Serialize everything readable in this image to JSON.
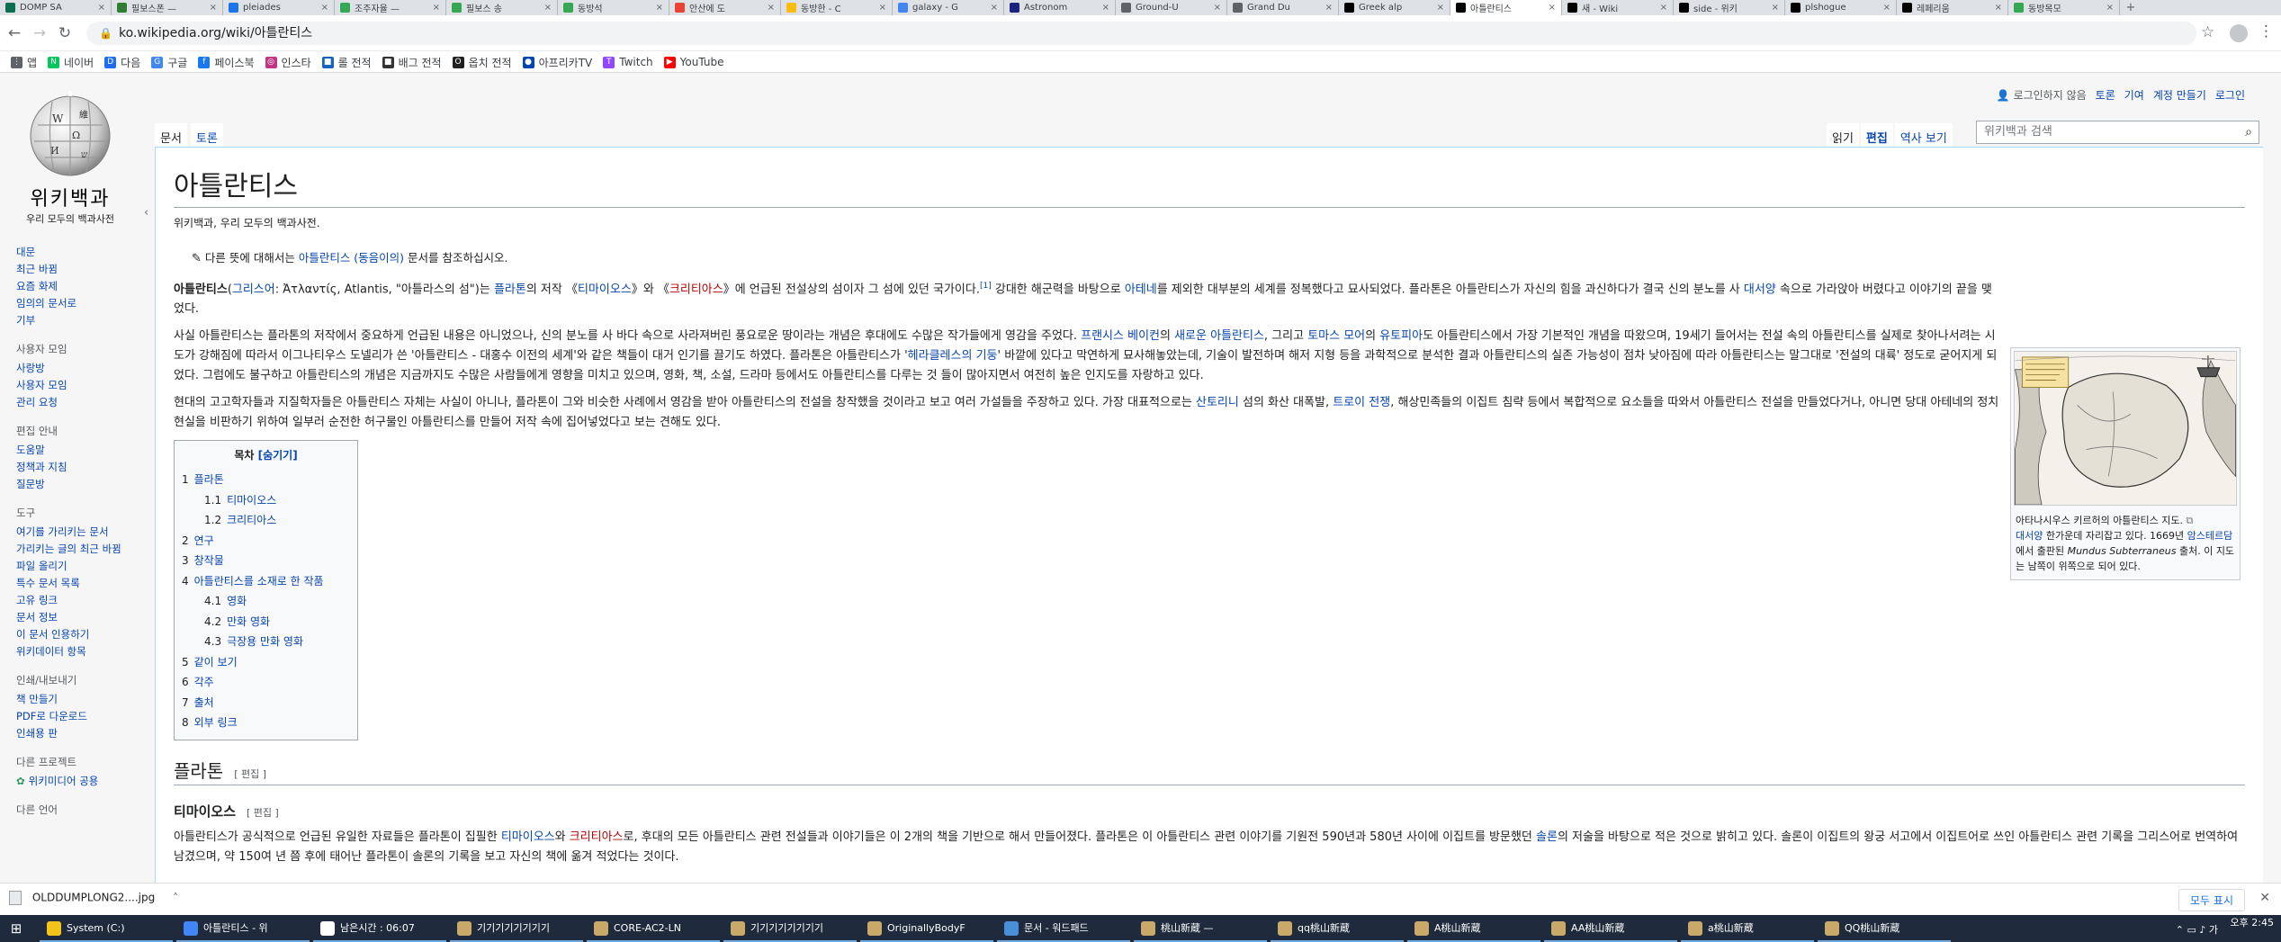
{
  "browser": {
    "tabs": [
      {
        "title": "DOMP SA",
        "color": "#0b6e4f"
      },
      {
        "title": "필보스폰 —",
        "color": "#2e7d32"
      },
      {
        "title": "pleiades",
        "color": "#1a73e8"
      },
      {
        "title": "조주자율 —",
        "color": "#34a853"
      },
      {
        "title": "필보스 송",
        "color": "#34a853"
      },
      {
        "title": "동방석",
        "color": "#34a853"
      },
      {
        "title": "안산에 도",
        "color": "#ea4335"
      },
      {
        "title": "동방한 - C",
        "color": "#fbbc04"
      },
      {
        "title": "galaxy - G",
        "color": "#4285f4"
      },
      {
        "title": "Astronom",
        "color": "#1a237e"
      },
      {
        "title": "Ground-U",
        "color": "#5f6368"
      },
      {
        "title": "Grand Du",
        "color": "#5f6368"
      },
      {
        "title": "Greek alp",
        "color": "#000000"
      },
      {
        "title": "아틀란티스",
        "color": "#000000",
        "active": true
      },
      {
        "title": "새 - Wiki",
        "color": "#000000"
      },
      {
        "title": "side - 위키",
        "color": "#000000"
      },
      {
        "title": "plshogue",
        "color": "#000000"
      },
      {
        "title": "레페리움",
        "color": "#000000"
      },
      {
        "title": "동방목모",
        "color": "#34a853"
      }
    ],
    "new_tab": "+",
    "url": "ko.wikipedia.org/wiki/아틀란티스",
    "bookmarks": [
      {
        "label": "앱",
        "color": "#5f6368",
        "glyph": "⋮"
      },
      {
        "label": "네이버",
        "color": "#03c75a",
        "glyph": "N"
      },
      {
        "label": "다음",
        "color": "#1e6ef4",
        "glyph": "D"
      },
      {
        "label": "구글",
        "color": "#4285f4",
        "glyph": "G"
      },
      {
        "label": "페이스북",
        "color": "#1877f2",
        "glyph": "f"
      },
      {
        "label": "인스타",
        "color": "#c13584",
        "glyph": "◎"
      },
      {
        "label": "롤 전적",
        "color": "#1565c0",
        "glyph": "■"
      },
      {
        "label": "배그 전적",
        "color": "#333333",
        "glyph": "■"
      },
      {
        "label": "옵치 전적",
        "color": "#222222",
        "glyph": "O"
      },
      {
        "label": "아프리카TV",
        "color": "#0545b1",
        "glyph": "●"
      },
      {
        "label": "Twitch",
        "color": "#9146ff",
        "glyph": "T"
      },
      {
        "label": "YouTube",
        "color": "#ff0000",
        "glyph": "▶"
      }
    ]
  },
  "wiki": {
    "logo_title": "위키백과",
    "logo_sub": "우리 모두의 백과사전",
    "sidebar": {
      "nav": [
        "대문",
        "최근 바뀜",
        "요즘 화제",
        "임의의 문서로",
        "기부"
      ],
      "sections": [
        {
          "heading": "사용자 모임",
          "items": [
            "사랑방",
            "사용자 모임",
            "관리 요청"
          ]
        },
        {
          "heading": "편집 안내",
          "items": [
            "도움말",
            "정책과 지침",
            "질문방"
          ]
        },
        {
          "heading": "도구",
          "items": [
            "여기를 가리키는 문서",
            "가리키는 글의 최근 바뀜",
            "파일 올리기",
            "특수 문서 목록",
            "고유 링크",
            "문서 정보",
            "이 문서 인용하기",
            "위키데이터 항목"
          ]
        },
        {
          "heading": "인쇄/내보내기",
          "items": [
            "책 만들기",
            "PDF로 다운로드",
            "인쇄용 판"
          ]
        },
        {
          "heading": "다른 프로젝트",
          "items": [
            "위키미디어 공용"
          ]
        },
        {
          "heading": "다른 언어",
          "items": []
        }
      ]
    },
    "personal": [
      "로그인하지 않음",
      "토론",
      "기여",
      "계정 만들기",
      "로그인"
    ],
    "left_tabs": [
      "문서",
      "토론"
    ],
    "right_tabs": [
      "읽기",
      "편집",
      "역사 보기"
    ],
    "search_placeholder": "위키백과 검색",
    "title": "아틀란티스",
    "site_sub": "위키백과, 우리 모두의 백과사전.",
    "hatnote_pre": "다른 뜻에 대해서는 ",
    "hatnote_link": "아틀란티스 (동음이의)",
    "hatnote_post": " 문서를 참조하십시오.",
    "p1": {
      "a": "아틀란티스",
      "b": "(",
      "c": "그리스어",
      "d": ": Ἀτλαντίς, Atlantis, \"아틀라스의 섬\")는 ",
      "e": "플라톤",
      "f": "의 저작 《",
      "g": "티마이오스",
      "h": "》와 《",
      "i": "크리티아스",
      "j": "》에 언급된 전설상의 섬이자 그 섬에 있던 국가이다.",
      "k": "[1]",
      "l": " 강대한 해군력을 바탕으로 ",
      "m": "아테네",
      "n": "를 제외한 대부분의 세계를 정복했다고 묘사되었다. 플라톤은 아틀란티스가 자신의 힘을 과신하다가 결국 신의 분노를 사 ",
      "o": "대서양",
      "p": " 속으로 가라앉아 버렸다고 이야기의 끝을 맺었다."
    },
    "p2": {
      "a": "사실 아틀란티스는 플라톤의 저작에서 중요하게 언급된 내용은 아니었으나, 신의 분노를 사 바다 속으로 사라져버린 풍요로운 땅이라는 개념은 후대에도 수많은 작가들에게 영감을 주었다. ",
      "b": "프랜시스 베이컨",
      "c": "의 ",
      "d": "새로운 아틀란티스",
      "e": ", 그리고 ",
      "f": "토마스 모어",
      "g": "의 ",
      "h": "유토피아",
      "i": "도 아틀란티스에서 가장 기본적인 개념을 따왔으며, 19세기 들어서는 전설 속의 아틀란티스를 실제로 찾아나서려는 시도가 강해짐에 따라서 이그나티우스 도넬리가 쓴 '아틀란티스 - 대홍수 이전의 세계'와 같은 책들이 대거 인기를 끌기도 하였다. 플라톤은 아틀란티스가 '",
      "j": "헤라클레스의 기둥",
      "k": "' 바깥에 있다고 막연하게 묘사해놓았는데, 기술이 발전하며 해저 지형 등을 과학적으로 분석한 결과 아틀란티스의 실존 가능성이 점차 낮아짐에 따라 아틀란티스는 말그대로 '전설의 대륙' 정도로 굳어지게 되었다. 그럼에도 불구하고 아틀란티스의 개념은 지금까지도 수많은 사람들에게 영향을 미치고 있으며, 영화, 책, 소설, 드라마 등에서도 아틀란티스를 다루는 것 들이 많아지면서 여전히 높은 인지도를 자랑하고 있다."
    },
    "p3": {
      "a": "현대의 고고학자들과 지질학자들은 아틀란티스 자체는 사실이 아니나, 플라톤이 그와 비슷한 사례에서 영감을 받아 아틀란티스의 전설을 창작했을 것이라고 보고 여러 가설들을 주장하고 있다. 가장 대표적으로는 ",
      "b": "산토리니",
      "c": " 섬의 화산 대폭발, ",
      "d": "트로이 전쟁",
      "e": ", 해상민족들의 이집트 침략 등에서 복합적으로 요소들을 따와서 아틀란티스 전설을 만들었다거나, 아니면 당대 아테네의 정치 현실을 비판하기 위하여 일부러 순전한 허구물인 아틀란티스를 만들어 저작 속에 집어넣었다고 보는 견해도 있다."
    },
    "thumb": {
      "a": "아타나시우스 키르허의 아틀란티스 지도. ",
      "b": "대서양",
      "c": " 한가운데 자리잡고 있다. 1669년 ",
      "d": "암스테르담",
      "e": "에서 출판된 ",
      "f": "Mundus Subterraneus",
      "g": " 출처. 이 지도는 남쪽이 위쪽으로 되어 있다."
    },
    "toc": {
      "title": "목차",
      "toggle": "[숨기기]",
      "entries": [
        {
          "num": "1",
          "label": "플라톤",
          "level": 1
        },
        {
          "num": "1.1",
          "label": "티마이오스",
          "level": 2
        },
        {
          "num": "1.2",
          "label": "크리티아스",
          "level": 2
        },
        {
          "num": "2",
          "label": "연구",
          "level": 1
        },
        {
          "num": "3",
          "label": "창작물",
          "level": 1
        },
        {
          "num": "4",
          "label": "아틀란티스를 소재로 한 작품",
          "level": 1
        },
        {
          "num": "4.1",
          "label": "영화",
          "level": 2
        },
        {
          "num": "4.2",
          "label": "만화 영화",
          "level": 2
        },
        {
          "num": "4.3",
          "label": "극장용 만화 영화",
          "level": 2
        },
        {
          "num": "5",
          "label": "같이 보기",
          "level": 1
        },
        {
          "num": "6",
          "label": "각주",
          "level": 1
        },
        {
          "num": "7",
          "label": "출처",
          "level": 1
        },
        {
          "num": "8",
          "label": "외부 링크",
          "level": 1
        }
      ]
    },
    "h2_plato": "플라톤",
    "h3_timaeus": "티마이오스",
    "edit_label": "[ 편집 ]",
    "p4": {
      "a": "아틀란티스가 공식적으로 언급된 유일한 자료들은 플라톤이 집필한 ",
      "b": "티마이오스",
      "c": "와 ",
      "d": "크리티아스",
      "e": "로, 후대의 모든 아틀란티스 관련 전설들과 이야기들은 이 2개의 책을 기반으로 해서 만들어졌다. 플라톤은 이 아틀란티스 관련 이야기를 기원전 590년과 580년 사이에 이집트를 방문했던 ",
      "f": "솔론",
      "g": "의 저술을 바탕으로 적은 것으로 밝히고 있다. 솔론이 이집트의 왕궁 서고에서 이집트어로 쓰인 아틀란티스 관련 기록을 그리스어로 번역하여 남겼으며, 약 150여 년 쯤 후에 태어난 플라톤이 솔론의 기록을 보고 자신의 책에 옮겨 적었다는 것이다."
    }
  },
  "download": {
    "file": "OLDDUMPLONG2....jpg",
    "show_all": "모두 표시",
    "close": "✕"
  },
  "taskbar": {
    "items": [
      {
        "label": "System (C:)",
        "color": "#f0c419"
      },
      {
        "label": "아틀란티스 - 위",
        "color": "#4285f4"
      },
      {
        "label": "남은시간 : 06:07",
        "color": "#ffffff"
      },
      {
        "label": "기기기기기기기기",
        "color": "#c8a96a"
      },
      {
        "label": "CORE-AC2-LN",
        "color": "#c8a96a"
      },
      {
        "label": "기기기기기기기기",
        "color": "#c8a96a"
      },
      {
        "label": "OriginallyBodyF",
        "color": "#c8a96a"
      },
      {
        "label": "문서 - 워드패드",
        "color": "#4a90d9"
      },
      {
        "label": "桃山新蔵 —",
        "color": "#c8a96a"
      },
      {
        "label": "qq桃山新蔵",
        "color": "#c8a96a"
      },
      {
        "label": "A桃山新蔵",
        "color": "#c8a96a"
      },
      {
        "label": "AA桃山新蔵",
        "color": "#c8a96a"
      },
      {
        "label": "a桃山新蔵",
        "color": "#c8a96a"
      },
      {
        "label": "QQ桃山新蔵",
        "color": "#c8a96a"
      }
    ],
    "time": "오후 2:45"
  }
}
